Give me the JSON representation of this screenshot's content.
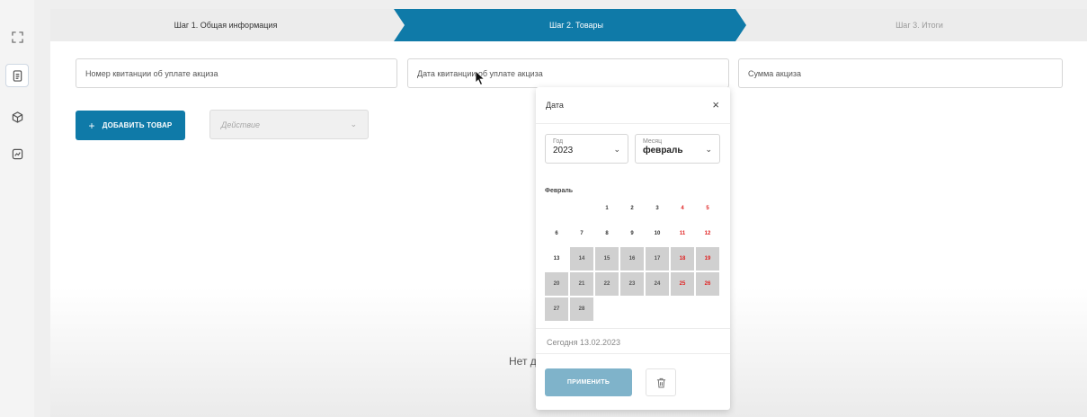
{
  "rail": {
    "items": [
      {
        "icon": "expand-icon"
      },
      {
        "icon": "document-icon",
        "active": true
      },
      {
        "icon": "cube-icon"
      },
      {
        "icon": "chart-icon"
      }
    ]
  },
  "stepper": {
    "steps": [
      {
        "label": "Шаг 1. Общая информация",
        "state": "done"
      },
      {
        "label": "Шаг 2. Товары",
        "state": "active"
      },
      {
        "label": "Шаг 3. Итоги",
        "state": "pending"
      }
    ],
    "colors": {
      "active": "#0f7aa8",
      "inactive": "#ececec"
    }
  },
  "form": {
    "receipt_number_placeholder": "Номер квитанции об уплате акциза",
    "receipt_date_placeholder": "Дата квитанции об уплате акциза",
    "excise_sum_placeholder": "Сумма акциза"
  },
  "toolbar": {
    "add_label": "ДОБАВИТЬ ТОВАР",
    "add_icon": "+",
    "action_placeholder": "Действие"
  },
  "empty_state": "Нет д",
  "datepicker": {
    "title": "Дата",
    "close": "×",
    "year_caption": "Год",
    "year_value": "2023",
    "month_caption": "Месяц",
    "month_value": "февраль",
    "month_label": "Февраль",
    "days": [
      {
        "d": "1",
        "weekend": false,
        "disabled": false
      },
      {
        "d": "2",
        "weekend": false,
        "disabled": false
      },
      {
        "d": "3",
        "weekend": false,
        "disabled": false
      },
      {
        "d": "4",
        "weekend": true,
        "disabled": false
      },
      {
        "d": "5",
        "weekend": true,
        "disabled": false
      },
      {
        "d": "6",
        "weekend": false,
        "disabled": false
      },
      {
        "d": "7",
        "weekend": false,
        "disabled": false
      },
      {
        "d": "8",
        "weekend": false,
        "disabled": false
      },
      {
        "d": "9",
        "weekend": false,
        "disabled": false
      },
      {
        "d": "10",
        "weekend": false,
        "disabled": false
      },
      {
        "d": "11",
        "weekend": true,
        "disabled": false
      },
      {
        "d": "12",
        "weekend": true,
        "disabled": false
      },
      {
        "d": "13",
        "weekend": false,
        "disabled": false
      },
      {
        "d": "14",
        "weekend": false,
        "disabled": true
      },
      {
        "d": "15",
        "weekend": false,
        "disabled": true
      },
      {
        "d": "16",
        "weekend": false,
        "disabled": true
      },
      {
        "d": "17",
        "weekend": false,
        "disabled": true
      },
      {
        "d": "18",
        "weekend": true,
        "disabled": true
      },
      {
        "d": "19",
        "weekend": true,
        "disabled": true
      },
      {
        "d": "20",
        "weekend": false,
        "disabled": true
      },
      {
        "d": "21",
        "weekend": false,
        "disabled": true
      },
      {
        "d": "22",
        "weekend": false,
        "disabled": true
      },
      {
        "d": "23",
        "weekend": false,
        "disabled": true
      },
      {
        "d": "24",
        "weekend": false,
        "disabled": true
      },
      {
        "d": "25",
        "weekend": true,
        "disabled": true
      },
      {
        "d": "26",
        "weekend": true,
        "disabled": true
      },
      {
        "d": "27",
        "weekend": false,
        "disabled": true
      },
      {
        "d": "28",
        "weekend": false,
        "disabled": true
      }
    ],
    "today_label": "Сегодня 13.02.2023",
    "apply_label": "ПРИМЕНИТЬ",
    "delete_icon": "trash-icon"
  }
}
